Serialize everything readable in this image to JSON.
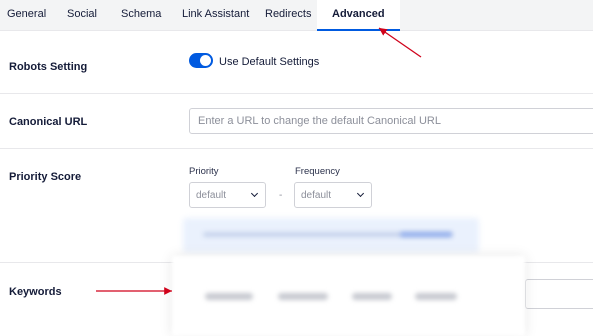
{
  "tabs": [
    {
      "label": "General"
    },
    {
      "label": "Social"
    },
    {
      "label": "Schema"
    },
    {
      "label": "Link Assistant"
    },
    {
      "label": "Redirects"
    },
    {
      "label": "Advanced",
      "active": true
    }
  ],
  "rows": {
    "robots": {
      "label": "Robots Setting",
      "toggle_on": true,
      "toggle_label": "Use Default Settings"
    },
    "canonical": {
      "label": "Canonical URL",
      "placeholder": "Enter a URL to change the default Canonical URL"
    },
    "priority": {
      "label": "Priority Score",
      "priority_label": "Priority",
      "priority_value": "default",
      "separator": "-",
      "frequency_label": "Frequency",
      "frequency_value": "default"
    },
    "keywords": {
      "label": "Keywords"
    }
  },
  "colors": {
    "accent": "#005ae0",
    "annotation_arrow": "#d0021b",
    "tab_bar": "#f3f4f5"
  }
}
